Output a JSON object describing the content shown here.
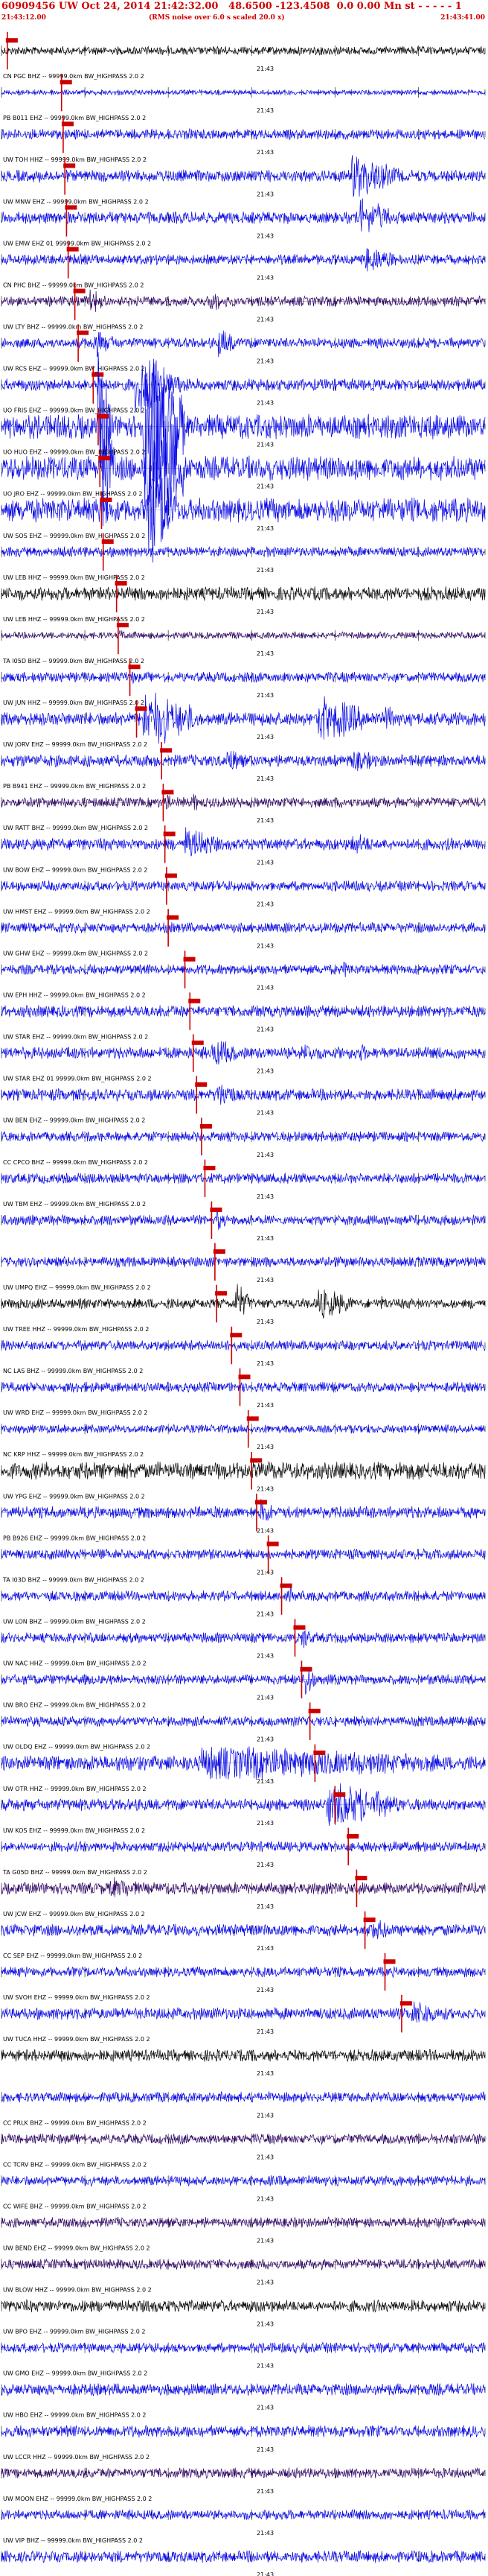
{
  "header": {
    "title": "60909456 UW Oct 24, 2014 21:42:32.00   48.6500 -123.4508  0.0 0.00 Mn st - - - - - 1",
    "start_time": "21:43:12.00",
    "note": "(RMS noise over 6.0 s scaled 20.0 x)",
    "end_time": "21:43:41.00"
  },
  "chart_data": {
    "type": "line",
    "time_label": "21:43",
    "x_range_seconds": [
      0,
      29
    ],
    "colors": {
      "blue": "#0000e6",
      "black": "#000000",
      "purple": "#2a0060",
      "pick": "#cc0000",
      "hdr": "#d00000"
    },
    "traces": [
      {
        "label": "",
        "color": "black",
        "amp": 0.25,
        "pick": 0.35,
        "bursts": []
      },
      {
        "label": "CN PGC BHZ -- 99999.0km BW_HIGHPASS 2.0 2",
        "color": "blue",
        "amp": 0.15,
        "pick": 3.6,
        "bursts": []
      },
      {
        "label": "PB B011 EHZ -- 99999.0km BW_HIGHPASS 2.0 2",
        "color": "blue",
        "amp": 0.3,
        "pick": 3.7,
        "bursts": []
      },
      {
        "label": "UW TOH HHZ -- 99999.0km BW_HIGHPASS 2.0 2",
        "color": "blue",
        "amp": 0.35,
        "pick": 3.8,
        "bursts": [
          [
            21,
            24,
            2.6
          ]
        ]
      },
      {
        "label": "UW MNW EHZ -- 99999.0km BW_HIGHPASS 2.0 2",
        "color": "blue",
        "amp": 0.35,
        "pick": 3.9,
        "bursts": [
          [
            21.5,
            24,
            2.2
          ]
        ]
      },
      {
        "label": "UW EMW EHZ 01 99999.0km BW_HIGHPASS 2.0 2",
        "color": "blue",
        "amp": 0.3,
        "pick": 4.0,
        "bursts": [
          [
            21.8,
            24,
            1.8
          ]
        ]
      },
      {
        "label": "CN PHC BHZ -- 99999.0km BW_HIGHPASS 2.0 2",
        "color": "purple",
        "amp": 0.3,
        "pick": 4.4,
        "bursts": [
          [
            5.3,
            6.5,
            1.8
          ],
          [
            12.5,
            14,
            1.4
          ]
        ]
      },
      {
        "label": "UW LTY BHZ -- 99999.0km BW_HIGHPASS 2.0 2",
        "color": "blue",
        "amp": 0.3,
        "pick": 4.6,
        "bursts": [
          [
            5.5,
            7,
            2
          ],
          [
            13,
            14.5,
            2
          ]
        ]
      },
      {
        "label": "UW RCS EHZ -- 99999.0km BW_HIGHPASS 2.0 2",
        "color": "blue",
        "amp": 0.35,
        "pick": 5.5,
        "bursts": [
          [
            5.7,
            6.5,
            2
          ],
          [
            8,
            11,
            3.4
          ]
        ]
      },
      {
        "label": "UO FRIS EHZ -- 99999.0km BW_HIGHPASS 2.0 2",
        "color": "blue",
        "amp": 0.7,
        "pick": 5.8,
        "bursts": [
          [
            5.8,
            6.6,
            4
          ],
          [
            8.5,
            11,
            5
          ]
        ]
      },
      {
        "label": "UO HUO EHZ -- 99999.0km BW_HIGHPASS 2.0 2",
        "color": "blue",
        "amp": 0.7,
        "pick": 5.9,
        "bursts": [
          [
            6,
            6.8,
            4
          ],
          [
            8.6,
            11,
            5
          ]
        ]
      },
      {
        "label": "UO JRO EHZ -- 99999.0km BW_HIGHPASS 2.0 2",
        "color": "blue",
        "amp": 0.7,
        "pick": 6.0,
        "bursts": [
          [
            6,
            6.5,
            2
          ],
          [
            8.8,
            10.5,
            3.5
          ]
        ]
      },
      {
        "label": "UW SOS EHZ -- 99999.0km BW_HIGHPASS 2.0 2",
        "color": "blue",
        "amp": 0.3,
        "pick": 6.1,
        "bursts": []
      },
      {
        "label": "UW LEB HHZ -- 99999.0km BW_HIGHPASS 2.0 2",
        "color": "black",
        "amp": 0.4,
        "pick": 6.9,
        "bursts": []
      },
      {
        "label": "UW LEB HHZ -- 99999.0km BW_HIGHPASS 2.0 2",
        "color": "purple",
        "amp": 0.2,
        "pick": 7.0,
        "bursts": [
          [
            7,
            8,
            1.2
          ]
        ]
      },
      {
        "label": "TA I05D BHZ -- 99999.0km BW_HIGHPASS 2.0 2",
        "color": "blue",
        "amp": 0.3,
        "pick": 7.7,
        "bursts": [
          [
            7.7,
            8,
            1.5
          ]
        ]
      },
      {
        "label": "UW JUN HHZ -- 99999.0km BW_HIGHPASS 2.0 2",
        "color": "blue",
        "amp": 0.4,
        "pick": 8.1,
        "bursts": [
          [
            8.5,
            12,
            3
          ],
          [
            19,
            22,
            2.6
          ],
          [
            23,
            24,
            1.5
          ]
        ]
      },
      {
        "label": "UW JORV EHZ -- 99999.0km BW_HIGHPASS 2.0 2",
        "color": "blue",
        "amp": 0.35,
        "pick": 9.6,
        "bursts": [
          [
            13.5,
            15,
            1.5
          ],
          [
            21,
            23,
            1.4
          ]
        ]
      },
      {
        "label": "PB B941 EHZ -- 99999.0km BW_HIGHPASS 2.0 2",
        "color": "purple",
        "amp": 0.3,
        "pick": 9.7,
        "bursts": [
          [
            9.8,
            10.2,
            1.8
          ],
          [
            11.5,
            12,
            1.4
          ]
        ]
      },
      {
        "label": "UW RATT BHZ -- 99999.0km BW_HIGHPASS 2.0 2",
        "color": "blue",
        "amp": 0.35,
        "pick": 9.8,
        "bursts": [
          [
            11,
            13,
            2.2
          ],
          [
            21,
            23,
            1.3
          ]
        ]
      },
      {
        "label": "UW BOW EHZ -- 99999.0km BW_HIGHPASS 2.0 2",
        "color": "blue",
        "amp": 0.3,
        "pick": 9.9,
        "bursts": []
      },
      {
        "label": "UW HMST EHZ -- 99999.0km BW_HIGHPASS 2.0 2",
        "color": "blue",
        "amp": 0.3,
        "pick": 10.0,
        "bursts": []
      },
      {
        "label": "UW GHW EHZ -- 99999.0km BW_HIGHPASS 2.0 2",
        "color": "blue",
        "amp": 0.3,
        "pick": 11.0,
        "bursts": [
          [
            20.5,
            21,
            1.4
          ]
        ]
      },
      {
        "label": "UW EPH HHZ -- 99999.0km BW_HIGHPASS 2.0 2",
        "color": "blue",
        "amp": 0.35,
        "pick": 11.3,
        "bursts": []
      },
      {
        "label": "UW STAR EHZ -- 99999.0km BW_HIGHPASS 2.0 2",
        "color": "blue",
        "amp": 0.35,
        "pick": 11.5,
        "bursts": [
          [
            12.6,
            14.5,
            1.8
          ],
          [
            18,
            19.5,
            1.4
          ],
          [
            21.5,
            22,
            1.3
          ]
        ]
      },
      {
        "label": "UW STAR EHZ 01 99999.0km BW_HIGHPASS 2.0 2",
        "color": "blue",
        "amp": 0.35,
        "pick": 11.7,
        "bursts": [
          [
            12.8,
            14.5,
            1.6
          ]
        ]
      },
      {
        "label": "UW BEN EHZ -- 99999.0km BW_HIGHPASS 2.0 2",
        "color": "blue",
        "amp": 0.3,
        "pick": 12.0,
        "bursts": []
      },
      {
        "label": "CC CPCO BHZ -- 99999.0km BW_HIGHPASS 2.0 2",
        "color": "blue",
        "amp": 0.3,
        "pick": 12.2,
        "bursts": []
      },
      {
        "label": "UW TBM EHZ -- 99999.0km BW_HIGHPASS 2.0 2",
        "color": "blue",
        "amp": 0.3,
        "pick": 12.6,
        "bursts": [
          [
            12.8,
            13.5,
            1.8
          ]
        ]
      },
      {
        "label": "",
        "color": "blue",
        "amp": 0.3,
        "pick": 12.8,
        "bursts": []
      },
      {
        "label": "UW UMPQ EHZ -- 99999.0km BW_HIGHPASS 2.0 2",
        "color": "black",
        "amp": 0.3,
        "pick": 12.9,
        "bursts": [
          [
            14,
            15,
            2.8
          ],
          [
            19,
            21,
            2.4
          ],
          [
            22.8,
            23.3,
            1.2
          ]
        ]
      },
      {
        "label": "UW TREE HHZ -- 99999.0km BW_HIGHPASS 2.0 2",
        "color": "blue",
        "amp": 0.3,
        "pick": 13.8,
        "bursts": []
      },
      {
        "label": "NC LAS BHZ -- 99999.0km BW_HIGHPASS 2.0 2",
        "color": "blue",
        "amp": 0.3,
        "pick": 14.3,
        "bursts": []
      },
      {
        "label": "UW WRD EHZ -- 99999.0km BW_HIGHPASS 2.0 2",
        "color": "blue",
        "amp": 0.25,
        "pick": 14.8,
        "bursts": []
      },
      {
        "label": "NC KRP HHZ -- 99999.0km BW_HIGHPASS 2.0 2",
        "color": "black",
        "amp": 0.5,
        "pick": 15.0,
        "bursts": []
      },
      {
        "label": "UW YPG EHZ -- 99999.0km BW_HIGHPASS 2.0 2",
        "color": "blue",
        "amp": 0.35,
        "pick": 15.3,
        "bursts": [
          [
            15.5,
            16.5,
            1.6
          ]
        ]
      },
      {
        "label": "PB B926 EHZ -- 99999.0km BW_HIGHPASS 2.0 2",
        "color": "blue",
        "amp": 0.3,
        "pick": 16.0,
        "bursts": []
      },
      {
        "label": "TA I03D BHZ -- 99999.0km BW_HIGHPASS 2.0 2",
        "color": "blue",
        "amp": 0.3,
        "pick": 16.8,
        "bursts": [
          [
            17.3,
            17.8,
            1.3
          ]
        ]
      },
      {
        "label": "UW LON BHZ -- 99999.0km BW_HIGHPASS 2.0 2",
        "color": "blue",
        "amp": 0.3,
        "pick": 17.6,
        "bursts": [
          [
            18,
            18.8,
            1.6
          ]
        ]
      },
      {
        "label": "UW NAC HHZ -- 99999.0km BW_HIGHPASS 2.0 2",
        "color": "blue",
        "amp": 0.3,
        "pick": 18.0,
        "bursts": [
          [
            18.2,
            18.8,
            2.4
          ]
        ]
      },
      {
        "label": "UW BRO EHZ -- 99999.0km BW_HIGHPASS 2.0 2",
        "color": "blue",
        "amp": 0.3,
        "pick": 18.5,
        "bursts": []
      },
      {
        "label": "UW OLDQ EHZ -- 99999.0km BW_HIGHPASS 2.0 2",
        "color": "blue",
        "amp": 0.45,
        "pick": 18.8,
        "bursts": [
          [
            12,
            29,
            1.6
          ]
        ]
      },
      {
        "label": "UW OTR HHZ -- 99999.0km BW_HIGHPASS 2.0 2",
        "color": "blue",
        "amp": 0.35,
        "pick": 20.0,
        "bursts": [
          [
            19.5,
            24,
            2.8
          ]
        ]
      },
      {
        "label": "UW KOS EHZ -- 99999.0km BW_HIGHPASS 2.0 2",
        "color": "blue",
        "amp": 0.3,
        "pick": 20.8,
        "bursts": []
      },
      {
        "label": "TA G05D BHZ -- 99999.0km BW_HIGHPASS 2.0 2",
        "color": "purple",
        "amp": 0.35,
        "pick": 21.3,
        "bursts": [
          [
            6.5,
            9,
            1.4
          ]
        ]
      },
      {
        "label": "UW JCW EHZ -- 99999.0km BW_HIGHPASS 2.0 2",
        "color": "blue",
        "amp": 0.35,
        "pick": 21.8,
        "bursts": [
          [
            22,
            24,
            1.4
          ]
        ]
      },
      {
        "label": "CC SEP EHZ -- 99999.0km BW_HIGHPASS 2.0 2",
        "color": "blue",
        "amp": 0.3,
        "pick": 23.0,
        "bursts": []
      },
      {
        "label": "UW SVOH EHZ -- 99999.0km BW_HIGHPASS 2.0 2",
        "color": "blue",
        "amp": 0.35,
        "pick": 24.0,
        "bursts": [
          [
            24.5,
            27,
            1.5
          ]
        ]
      },
      {
        "label": "UW TUCA HHZ -- 99999.0km BW_HIGHPASS 2.0 2",
        "color": "black",
        "amp": 0.35,
        "pick": null,
        "bursts": []
      },
      {
        "label": "",
        "color": "blue",
        "amp": 0.3,
        "pick": null,
        "bursts": []
      },
      {
        "label": "CC PRLK BHZ -- 99999.0km BW_HIGHPASS 2.0 2",
        "color": "purple",
        "amp": 0.3,
        "pick": null,
        "bursts": []
      },
      {
        "label": "CC TCRV BHZ -- 99999.0km BW_HIGHPASS 2.0 2",
        "color": "blue",
        "amp": 0.3,
        "pick": null,
        "bursts": []
      },
      {
        "label": "CC WIFE BHZ -- 99999.0km BW_HIGHPASS 2.0 2",
        "color": "purple",
        "amp": 0.3,
        "pick": null,
        "bursts": []
      },
      {
        "label": "UW BEND EHZ -- 99999.0km BW_HIGHPASS 2.0 2",
        "color": "purple",
        "amp": 0.3,
        "pick": null,
        "bursts": []
      },
      {
        "label": "UW BLOW HHZ -- 99999.0km BW_HIGHPASS 2.0 2",
        "color": "black",
        "amp": 0.35,
        "pick": null,
        "bursts": []
      },
      {
        "label": "UW BPO EHZ -- 99999.0km BW_HIGHPASS 2.0 2",
        "color": "blue",
        "amp": 0.3,
        "pick": null,
        "bursts": []
      },
      {
        "label": "UW GMO EHZ -- 99999.0km BW_HIGHPASS 2.0 2",
        "color": "blue",
        "amp": 0.35,
        "pick": null,
        "bursts": []
      },
      {
        "label": "UW HBO EHZ -- 99999.0km BW_HIGHPASS 2.0 2",
        "color": "blue",
        "amp": 0.35,
        "pick": null,
        "bursts": []
      },
      {
        "label": "UW LCCR HHZ -- 99999.0km BW_HIGHPASS 2.0 2",
        "color": "purple",
        "amp": 0.3,
        "pick": null,
        "bursts": []
      },
      {
        "label": "UW MOON EHZ -- 99999.0km BW_HIGHPASS 2.0 2",
        "color": "blue",
        "amp": 0.3,
        "pick": null,
        "bursts": []
      },
      {
        "label": "UW VIP BHZ -- 99999.0km BW_HIGHPASS 2.0 2",
        "color": "blue",
        "amp": 0.35,
        "pick": null,
        "bursts": []
      }
    ]
  }
}
